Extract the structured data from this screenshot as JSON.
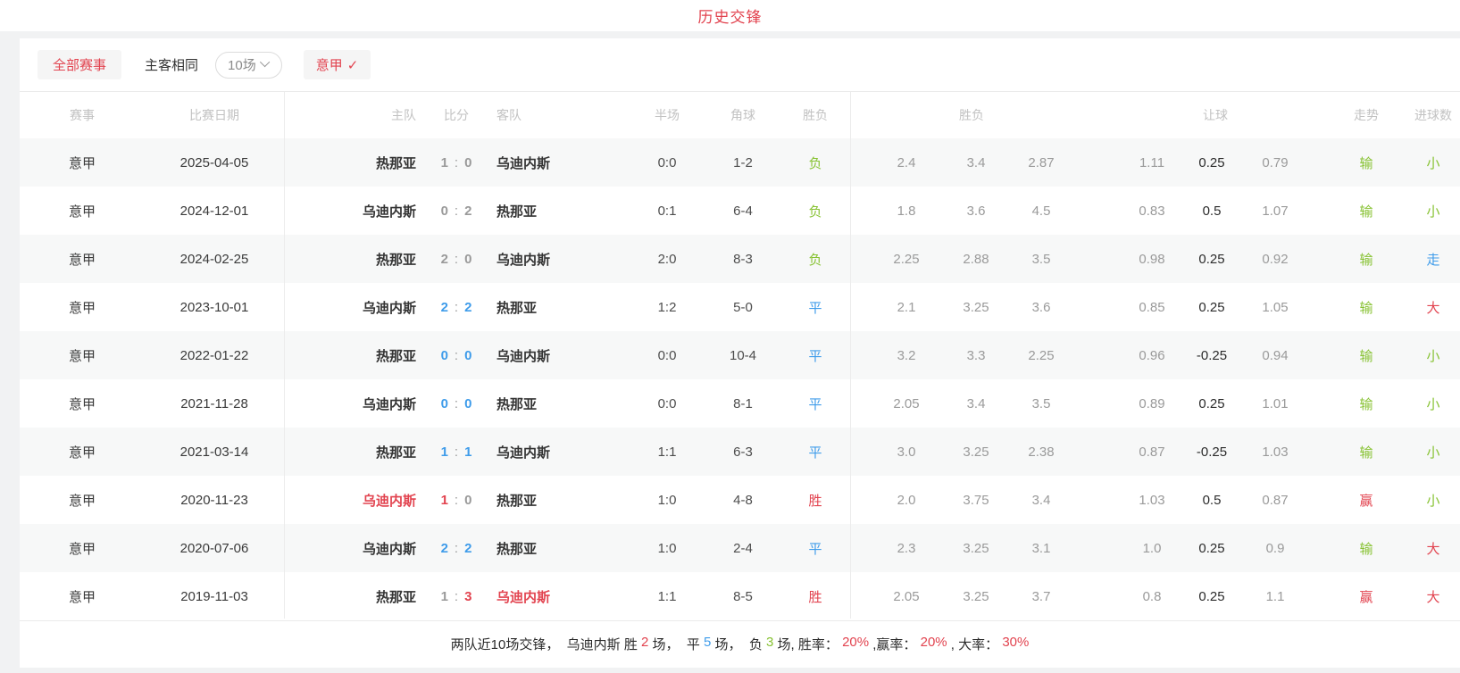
{
  "title": "历史交锋",
  "filters": {
    "all_matches": "全部赛事",
    "same_venue": "主客相同",
    "match_count": "10场",
    "league": "意甲",
    "league_check": "✓"
  },
  "table": {
    "headers": {
      "league": "赛事",
      "date": "比赛日期",
      "home": "主队",
      "score": "比分",
      "away": "客队",
      "half": "半场",
      "corner": "角球",
      "result": "胜负",
      "odds_group": "胜负",
      "handicap_group": "让球",
      "trend": "走势",
      "goals": "进球数"
    },
    "rows": [
      {
        "league": "意甲",
        "date": "2025-04-05",
        "home": "热那亚",
        "home_color": "dark",
        "score_home": "1",
        "score_home_color": "gray",
        "score_away": "0",
        "score_away_color": "gray",
        "away": "乌迪内斯",
        "away_color": "dark",
        "half": "0:0",
        "corner": "1-2",
        "result": "负",
        "result_color": "green",
        "odds": [
          "2.4",
          "3.4",
          "2.87"
        ],
        "handicap": [
          "1.11",
          "0.25",
          "0.79"
        ],
        "trend": "输",
        "trend_color": "green",
        "goals": "小",
        "goals_color": "green"
      },
      {
        "league": "意甲",
        "date": "2024-12-01",
        "home": "乌迪内斯",
        "home_color": "dark",
        "score_home": "0",
        "score_home_color": "gray",
        "score_away": "2",
        "score_away_color": "gray",
        "away": "热那亚",
        "away_color": "dark",
        "half": "0:1",
        "corner": "6-4",
        "result": "负",
        "result_color": "green",
        "odds": [
          "1.8",
          "3.6",
          "4.5"
        ],
        "handicap": [
          "0.83",
          "0.5",
          "1.07"
        ],
        "trend": "输",
        "trend_color": "green",
        "goals": "小",
        "goals_color": "green"
      },
      {
        "league": "意甲",
        "date": "2024-02-25",
        "home": "热那亚",
        "home_color": "dark",
        "score_home": "2",
        "score_home_color": "gray",
        "score_away": "0",
        "score_away_color": "gray",
        "away": "乌迪内斯",
        "away_color": "dark",
        "half": "2:0",
        "corner": "8-3",
        "result": "负",
        "result_color": "green",
        "odds": [
          "2.25",
          "2.88",
          "3.5"
        ],
        "handicap": [
          "0.98",
          "0.25",
          "0.92"
        ],
        "trend": "输",
        "trend_color": "green",
        "goals": "走",
        "goals_color": "blue"
      },
      {
        "league": "意甲",
        "date": "2023-10-01",
        "home": "乌迪内斯",
        "home_color": "dark",
        "score_home": "2",
        "score_home_color": "blue",
        "score_away": "2",
        "score_away_color": "blue",
        "away": "热那亚",
        "away_color": "dark",
        "half": "1:2",
        "corner": "5-0",
        "result": "平",
        "result_color": "blue",
        "odds": [
          "2.1",
          "3.25",
          "3.6"
        ],
        "handicap": [
          "0.85",
          "0.25",
          "1.05"
        ],
        "trend": "输",
        "trend_color": "green",
        "goals": "大",
        "goals_color": "red"
      },
      {
        "league": "意甲",
        "date": "2022-01-22",
        "home": "热那亚",
        "home_color": "dark",
        "score_home": "0",
        "score_home_color": "blue",
        "score_away": "0",
        "score_away_color": "blue",
        "away": "乌迪内斯",
        "away_color": "dark",
        "half": "0:0",
        "corner": "10-4",
        "result": "平",
        "result_color": "blue",
        "odds": [
          "3.2",
          "3.3",
          "2.25"
        ],
        "handicap": [
          "0.96",
          "-0.25",
          "0.94"
        ],
        "trend": "输",
        "trend_color": "green",
        "goals": "小",
        "goals_color": "green"
      },
      {
        "league": "意甲",
        "date": "2021-11-28",
        "home": "乌迪内斯",
        "home_color": "dark",
        "score_home": "0",
        "score_home_color": "blue",
        "score_away": "0",
        "score_away_color": "blue",
        "away": "热那亚",
        "away_color": "dark",
        "half": "0:0",
        "corner": "8-1",
        "result": "平",
        "result_color": "blue",
        "odds": [
          "2.05",
          "3.4",
          "3.5"
        ],
        "handicap": [
          "0.89",
          "0.25",
          "1.01"
        ],
        "trend": "输",
        "trend_color": "green",
        "goals": "小",
        "goals_color": "green"
      },
      {
        "league": "意甲",
        "date": "2021-03-14",
        "home": "热那亚",
        "home_color": "dark",
        "score_home": "1",
        "score_home_color": "blue",
        "score_away": "1",
        "score_away_color": "blue",
        "away": "乌迪内斯",
        "away_color": "dark",
        "half": "1:1",
        "corner": "6-3",
        "result": "平",
        "result_color": "blue",
        "odds": [
          "3.0",
          "3.25",
          "2.38"
        ],
        "handicap": [
          "0.87",
          "-0.25",
          "1.03"
        ],
        "trend": "输",
        "trend_color": "green",
        "goals": "小",
        "goals_color": "green"
      },
      {
        "league": "意甲",
        "date": "2020-11-23",
        "home": "乌迪内斯",
        "home_color": "red",
        "score_home": "1",
        "score_home_color": "red",
        "score_away": "0",
        "score_away_color": "gray",
        "away": "热那亚",
        "away_color": "dark",
        "half": "1:0",
        "corner": "4-8",
        "result": "胜",
        "result_color": "red",
        "odds": [
          "2.0",
          "3.75",
          "3.4"
        ],
        "handicap": [
          "1.03",
          "0.5",
          "0.87"
        ],
        "trend": "赢",
        "trend_color": "red",
        "goals": "小",
        "goals_color": "green"
      },
      {
        "league": "意甲",
        "date": "2020-07-06",
        "home": "乌迪内斯",
        "home_color": "dark",
        "score_home": "2",
        "score_home_color": "blue",
        "score_away": "2",
        "score_away_color": "blue",
        "away": "热那亚",
        "away_color": "dark",
        "half": "1:0",
        "corner": "2-4",
        "result": "平",
        "result_color": "blue",
        "odds": [
          "2.3",
          "3.25",
          "3.1"
        ],
        "handicap": [
          "1.0",
          "0.25",
          "0.9"
        ],
        "trend": "输",
        "trend_color": "green",
        "goals": "大",
        "goals_color": "red"
      },
      {
        "league": "意甲",
        "date": "2019-11-03",
        "home": "热那亚",
        "home_color": "dark",
        "score_home": "1",
        "score_home_color": "gray",
        "score_away": "3",
        "score_away_color": "red",
        "away": "乌迪内斯",
        "away_color": "red",
        "half": "1:1",
        "corner": "8-5",
        "result": "胜",
        "result_color": "red",
        "odds": [
          "2.05",
          "3.25",
          "3.7"
        ],
        "handicap": [
          "0.8",
          "0.25",
          "1.1"
        ],
        "trend": "赢",
        "trend_color": "red",
        "goals": "大",
        "goals_color": "red"
      }
    ]
  },
  "summary": {
    "segments": [
      {
        "text": "两队近10场交锋，  乌迪内斯 胜 ",
        "color": "dark"
      },
      {
        "text": "2",
        "color": "red"
      },
      {
        "text": " 场，  平 ",
        "color": "dark"
      },
      {
        "text": "5",
        "color": "blue"
      },
      {
        "text": " 场，  负 ",
        "color": "dark"
      },
      {
        "text": "3",
        "color": "green"
      },
      {
        "text": " 场, 胜率： ",
        "color": "dark"
      },
      {
        "text": "20%",
        "color": "red"
      },
      {
        "text": " ,赢率： ",
        "color": "dark"
      },
      {
        "text": "20%",
        "color": "red"
      },
      {
        "text": " , 大率： ",
        "color": "dark"
      },
      {
        "text": "30%",
        "color": "red"
      }
    ]
  },
  "colors": {
    "accent_red": "#e2434f",
    "draw_blue": "#3f9cea",
    "loss_green": "#87c232",
    "odds_gray": "#9a9a9a",
    "stripe_gray": "#f7f8f8"
  }
}
